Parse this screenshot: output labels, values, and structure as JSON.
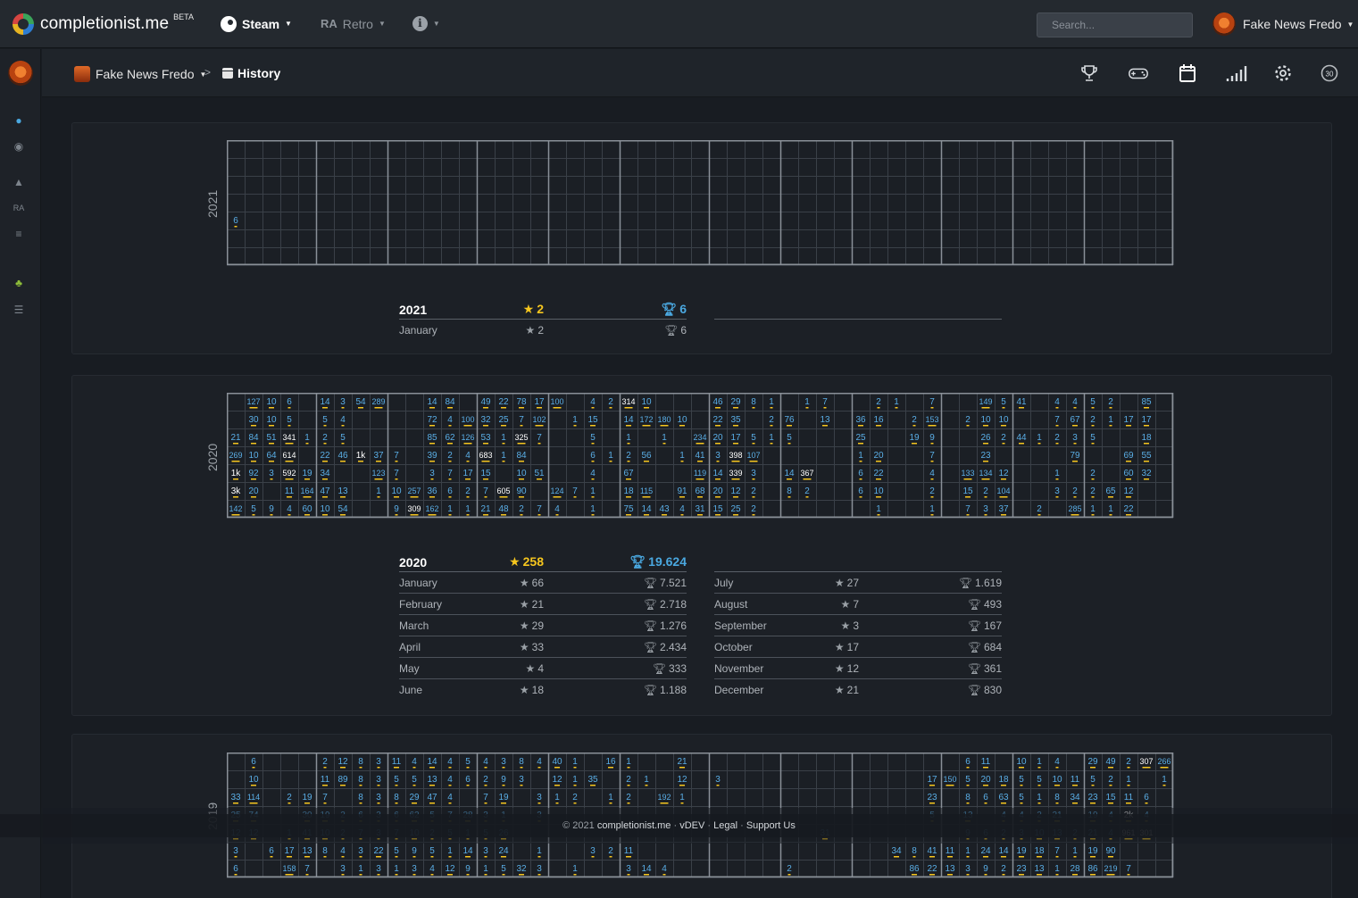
{
  "app": {
    "name": "completionist.me",
    "beta": "BETA"
  },
  "nav": {
    "steam": "Steam",
    "retro_prefix": "RA",
    "retro": "Retro",
    "info": "i"
  },
  "search": {
    "placeholder": "Search..."
  },
  "user": {
    "name": "Fake News Fredo"
  },
  "breadcrumb": {
    "user": "Fake News Fredo",
    "separator": ">",
    "page": "History"
  },
  "toolbar": {
    "badge": "30"
  },
  "colors": {
    "accent_blue": "#4aa8e0",
    "accent_gold": "#f6c61e",
    "background": "#181c22"
  },
  "years": [
    {
      "year": "2021",
      "grid_values": [
        {
          "col": 1,
          "row": 4,
          "v": "6",
          "dot": "•"
        }
      ],
      "summary": {
        "year": "2021",
        "stars": "2",
        "trophies": "6",
        "left": [
          {
            "month": "January",
            "stars": "2",
            "trophies": "6"
          }
        ],
        "right": []
      }
    },
    {
      "year": "2020",
      "summary": {
        "year": "2020",
        "stars": "258",
        "trophies": "19.624",
        "left": [
          {
            "month": "January",
            "stars": "66",
            "trophies": "7.521"
          },
          {
            "month": "February",
            "stars": "21",
            "trophies": "2.718"
          },
          {
            "month": "March",
            "stars": "29",
            "trophies": "1.276"
          },
          {
            "month": "April",
            "stars": "33",
            "trophies": "2.434"
          },
          {
            "month": "May",
            "stars": "4",
            "trophies": "333"
          },
          {
            "month": "June",
            "stars": "18",
            "trophies": "1.188"
          }
        ],
        "right": [
          {
            "month": "July",
            "stars": "27",
            "trophies": "1.619"
          },
          {
            "month": "August",
            "stars": "7",
            "trophies": "493"
          },
          {
            "month": "September",
            "stars": "3",
            "trophies": "167"
          },
          {
            "month": "October",
            "stars": "17",
            "trophies": "684"
          },
          {
            "month": "November",
            "stars": "12",
            "trophies": "361"
          },
          {
            "month": "December",
            "stars": "21",
            "trophies": "830"
          }
        ]
      },
      "grid_rows": [
        [
          "",
          "127",
          "10",
          "6",
          "",
          "14",
          "3",
          "54",
          "289",
          "",
          "",
          "14",
          "84",
          "",
          "49",
          "22",
          "78",
          "17",
          "100",
          "",
          "4",
          "2",
          "314",
          "10",
          "",
          "",
          "",
          "46",
          "29",
          "8",
          "1",
          "",
          "1",
          "7",
          "",
          "",
          "2",
          "1",
          "",
          "7",
          "",
          "",
          "149",
          "5",
          "41",
          "",
          "4",
          "4",
          "5",
          "2",
          "",
          "85"
        ],
        [
          "",
          "30",
          "10",
          "5",
          "",
          "5",
          "4",
          "",
          "",
          "",
          "",
          "72",
          "4",
          "100",
          "32",
          "25",
          "7",
          "102",
          "",
          "1",
          "15",
          "",
          "14",
          "172",
          "180",
          "10",
          "",
          "22",
          "35",
          "",
          "2",
          "76",
          "",
          "13",
          "",
          "36",
          "16",
          "",
          "2",
          "153",
          "",
          "2",
          "10",
          "10",
          "",
          "",
          "7",
          "67",
          "2",
          "1",
          "17",
          "17"
        ],
        [
          "21",
          "84",
          "51",
          "341",
          "1",
          "2",
          "5",
          "",
          "",
          "",
          "",
          "85",
          "62",
          "126",
          "53",
          "1",
          "325",
          "7",
          "",
          "",
          "5",
          "",
          "1",
          "",
          "1",
          "",
          "234",
          "20",
          "17",
          "5",
          "1",
          "5",
          "",
          "",
          "",
          "25",
          "",
          "",
          "19",
          "9",
          "",
          "",
          "26",
          "2",
          "44",
          "1",
          "2",
          "3",
          "5",
          "",
          "",
          "18"
        ],
        [
          "269",
          "10",
          "64",
          "614",
          "",
          "22",
          "46",
          "1k",
          "37",
          "7",
          "",
          "39",
          "2",
          "4",
          "683",
          "1",
          "84",
          "",
          "",
          "",
          "6",
          "1",
          "2",
          "56",
          "",
          "1",
          "41",
          "3",
          "398",
          "107",
          "",
          "",
          "",
          "",
          "",
          "1",
          "20",
          "",
          "",
          "7",
          "",
          "",
          "23",
          "",
          "",
          "",
          "",
          "79",
          "",
          "",
          "69",
          "55"
        ],
        [
          "1k",
          "92",
          "3",
          "592",
          "19",
          "34",
          "",
          "",
          "123",
          "7",
          "",
          "3",
          "7",
          "17",
          "15",
          "",
          "10",
          "51",
          "",
          "",
          "4",
          "",
          "67",
          "",
          "",
          "",
          "119",
          "14",
          "339",
          "3",
          "",
          "14",
          "367",
          "",
          "",
          "6",
          "22",
          "",
          "",
          "4",
          "",
          "133",
          "134",
          "12",
          "",
          "",
          "1",
          "",
          "2",
          "",
          "60",
          "32"
        ],
        [
          "3k",
          "20",
          "",
          "11",
          "164",
          "47",
          "13",
          "",
          "1",
          "10",
          "257",
          "36",
          "6",
          "2",
          "7",
          "605",
          "90",
          "",
          "124",
          "7",
          "1",
          "",
          "18",
          "115",
          "",
          "91",
          "68",
          "20",
          "12",
          "2",
          "",
          "8",
          "2",
          "",
          "",
          "6",
          "10",
          "",
          "",
          "2",
          "",
          "15",
          "2",
          "104",
          "",
          "",
          "3",
          "2",
          "2",
          "65",
          "12"
        ],
        [
          "142",
          "5",
          "9",
          "4",
          "60",
          "10",
          "54",
          "",
          "",
          "9",
          "309",
          "162",
          "1",
          "1",
          "21",
          "48",
          "2",
          "7",
          "4",
          "",
          "1",
          "",
          "75",
          "14",
          "43",
          "4",
          "31",
          "15",
          "25",
          "2",
          "",
          "",
          "",
          "",
          "",
          "",
          "1",
          "",
          "",
          "1",
          "",
          "7",
          "3",
          "37",
          "",
          "2",
          "",
          "285",
          "1",
          "1",
          "22"
        ]
      ]
    },
    {
      "year": "2019",
      "grid_rows": [
        [
          "",
          "6",
          "",
          "",
          "",
          "2",
          "12",
          "8",
          "3",
          "11",
          "4",
          "14",
          "4",
          "5",
          "4",
          "3",
          "8",
          "4",
          "40",
          "1",
          "",
          "16",
          "1",
          "",
          "",
          "21",
          "",
          "",
          "",
          "",
          "",
          "",
          "",
          "",
          "",
          "",
          "",
          "",
          "",
          "",
          "",
          "6",
          "11",
          "",
          "10",
          "1",
          "4",
          "",
          "29",
          "49",
          "2",
          "307",
          "266"
        ],
        [
          "",
          "10",
          "",
          "",
          "",
          "11",
          "89",
          "8",
          "3",
          "5",
          "5",
          "13",
          "4",
          "6",
          "2",
          "9",
          "3",
          "",
          "12",
          "1",
          "35",
          "",
          "2",
          "1",
          "",
          "12",
          "",
          "3",
          "",
          "",
          "",
          "",
          "",
          "",
          "",
          "",
          "",
          "",
          "",
          "17",
          "150",
          "5",
          "20",
          "18",
          "5",
          "5",
          "10",
          "11",
          "5",
          "2",
          "1",
          "",
          "1"
        ],
        [
          "33",
          "114",
          "",
          "2",
          "19",
          "7",
          "",
          "8",
          "3",
          "8",
          "29",
          "47",
          "4",
          "",
          "7",
          "19",
          "",
          "3",
          "1",
          "2",
          "",
          "1",
          "2",
          "",
          "192",
          "1",
          "",
          "",
          "",
          "",
          "",
          "",
          "",
          "",
          "",
          "",
          "",
          "",
          "",
          "23",
          "",
          "8",
          "6",
          "63",
          "5",
          "1",
          "8",
          "34",
          "23",
          "15",
          "11",
          "6"
        ],
        [
          "25",
          "74",
          "",
          "",
          "30",
          "19",
          "2",
          "6",
          "3",
          "6",
          "62",
          "5",
          "7",
          "28",
          "3",
          "1",
          "",
          "3",
          "",
          "",
          "",
          "",
          "",
          "",
          "",
          "",
          "",
          "",
          "",
          "",
          "",
          "",
          "",
          "",
          "",
          "",
          "",
          "",
          "",
          "5",
          "",
          "13",
          "",
          "4",
          "4",
          "2",
          "21",
          "",
          "19",
          "4",
          "2k",
          "4"
        ],
        [
          "12",
          "12",
          "",
          "1",
          "41",
          "10",
          "2",
          "7",
          "3",
          "7",
          "10",
          "2",
          "5",
          "1",
          "5",
          "26",
          "",
          "",
          "",
          "",
          "",
          "",
          "",
          "",
          "",
          "",
          "",
          "",
          "",
          "",
          "",
          "",
          "",
          "31",
          "",
          "",
          "",
          "",
          "",
          "",
          "",
          "9",
          "6",
          "2",
          "3",
          "10",
          "13",
          "2",
          "21",
          "4",
          "961",
          "301"
        ],
        [
          "3",
          "",
          "6",
          "17",
          "13",
          "8",
          "4",
          "3",
          "22",
          "5",
          "9",
          "5",
          "1",
          "14",
          "3",
          "24",
          "",
          "1",
          "",
          "",
          "3",
          "2",
          "11",
          "",
          "",
          "",
          "",
          "",
          "",
          "",
          "",
          "",
          "",
          "",
          "",
          "",
          "",
          "34",
          "8",
          "41",
          "11",
          "1",
          "24",
          "14",
          "19",
          "18",
          "7",
          "1",
          "19",
          "90",
          ""
        ],
        [
          "6",
          "",
          "",
          "158",
          "7",
          "",
          "3",
          "1",
          "3",
          "1",
          "3",
          "4",
          "12",
          "9",
          "1",
          "5",
          "32",
          "3",
          "",
          "1",
          "",
          "",
          "3",
          "14",
          "4",
          "",
          "",
          "",
          "",
          "",
          "",
          "2",
          "",
          "",
          "",
          "",
          "",
          "",
          "86",
          "22",
          "13",
          "3",
          "9",
          "2",
          "23",
          "13",
          "1",
          "28",
          "86",
          "219",
          "7"
        ]
      ]
    }
  ],
  "footer": {
    "copyright": "© 2021",
    "site": "completionist.me",
    "by": "vDEV",
    "legal": "Legal",
    "support": "Support Us",
    "dot": "·"
  }
}
